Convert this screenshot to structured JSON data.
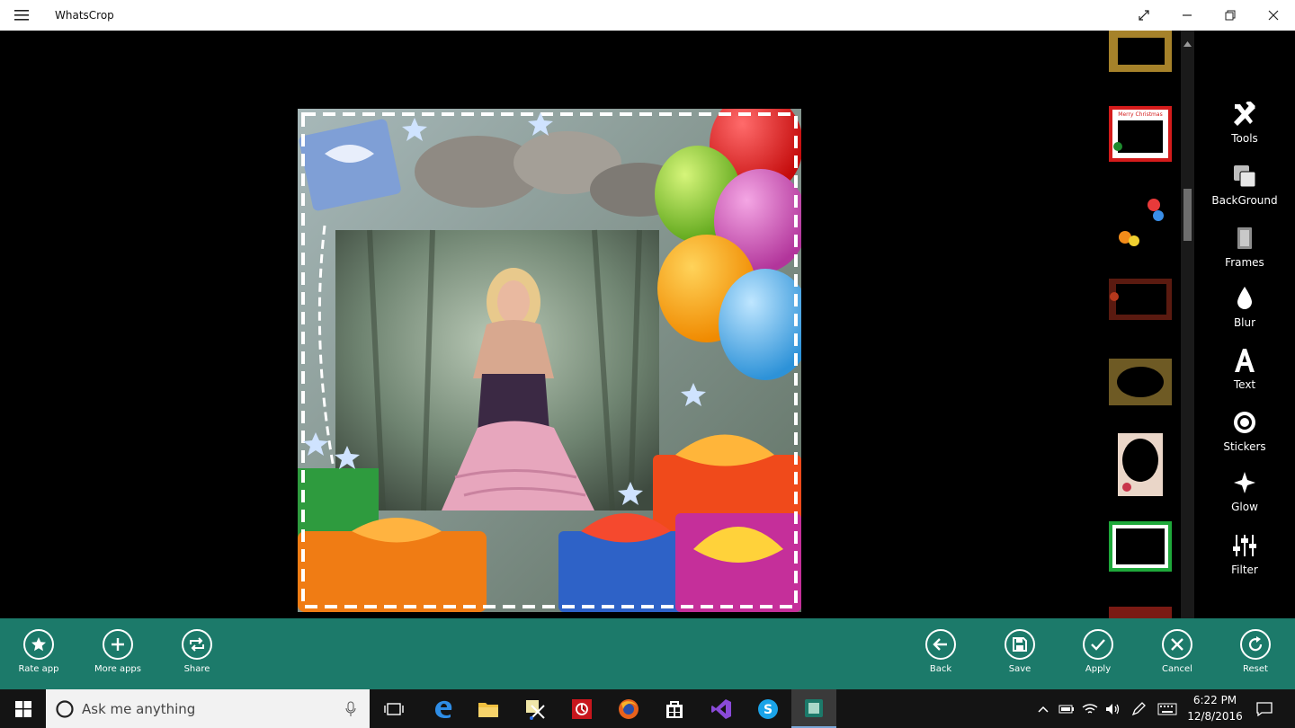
{
  "window": {
    "title": "WhatsCrop"
  },
  "tools": [
    {
      "label": "Tools",
      "icon": "hammer-wrench-icon"
    },
    {
      "label": "BackGround",
      "icon": "layers-icon"
    },
    {
      "label": "Frames",
      "icon": "frame-icon"
    },
    {
      "label": "Blur",
      "icon": "drop-icon"
    },
    {
      "label": "Text",
      "icon": "text-a-icon"
    },
    {
      "label": "Stickers",
      "icon": "sticker-icon"
    },
    {
      "label": "Glow",
      "icon": "sparkle-icon"
    },
    {
      "label": "Filter",
      "icon": "sliders-icon"
    }
  ],
  "frames_thumbnails": [
    {
      "icon": "frame-thumbnail-gold"
    },
    {
      "icon": "frame-thumbnail-christmas",
      "caption": "Merry Christmas"
    },
    {
      "icon": "frame-thumbnail-balloons"
    },
    {
      "icon": "frame-thumbnail-dark-red"
    },
    {
      "icon": "frame-thumbnail-vintage"
    },
    {
      "icon": "frame-thumbnail-oval"
    },
    {
      "icon": "frame-thumbnail-green"
    },
    {
      "icon": "frame-thumbnail-partial"
    }
  ],
  "appbar_left": [
    {
      "label": "Rate app",
      "icon": "star-icon"
    },
    {
      "label": "More apps",
      "icon": "plus-icon"
    },
    {
      "label": "Share",
      "icon": "share-icon"
    }
  ],
  "appbar_right": [
    {
      "label": "Back",
      "icon": "arrow-left-icon"
    },
    {
      "label": "Save",
      "icon": "save-icon"
    },
    {
      "label": "Apply",
      "icon": "check-icon"
    },
    {
      "label": "Cancel",
      "icon": "x-icon"
    },
    {
      "label": "Reset",
      "icon": "refresh-icon"
    }
  ],
  "taskbar": {
    "search_placeholder": "Ask me anything",
    "clock_time": "6:22 PM",
    "clock_date": "12/8/2016"
  },
  "colors": {
    "appbar": "#1c7a6a",
    "taskbar": "#141414"
  }
}
